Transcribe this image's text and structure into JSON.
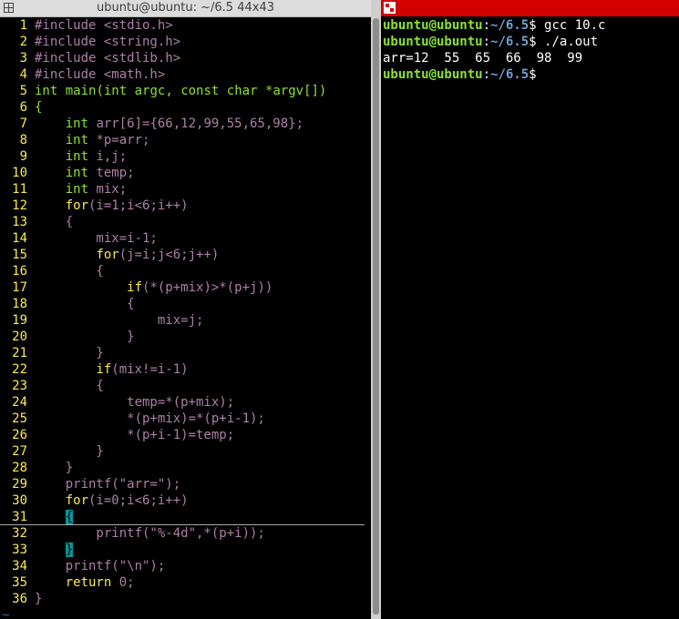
{
  "left_window": {
    "title": "ubuntu@ubuntu: ~/6.5 44x43",
    "lines": [
      {
        "n": "1",
        "parts": [
          [
            "c-pre",
            "#include "
          ],
          [
            "c-str",
            "<stdio.h>"
          ]
        ]
      },
      {
        "n": "2",
        "parts": [
          [
            "c-pre",
            "#include "
          ],
          [
            "c-str",
            "<string.h>"
          ]
        ]
      },
      {
        "n": "3",
        "parts": [
          [
            "c-pre",
            "#include "
          ],
          [
            "c-str",
            "<stdlib.h>"
          ]
        ]
      },
      {
        "n": "4",
        "parts": [
          [
            "c-pre",
            "#include "
          ],
          [
            "c-str",
            "<math.h>"
          ]
        ]
      },
      {
        "n": "5",
        "parts": [
          [
            "c-type",
            "int"
          ],
          [
            "c-type",
            " main("
          ],
          [
            "c-type",
            "int"
          ],
          [
            "c-type",
            " argc, "
          ],
          [
            "c-type",
            "const"
          ],
          [
            "c-type",
            " "
          ],
          [
            "c-type",
            "char"
          ],
          [
            "c-type",
            " *argv[])"
          ]
        ]
      },
      {
        "n": "6",
        "parts": [
          [
            "c-type",
            "{"
          ]
        ]
      },
      {
        "n": "7",
        "parts": [
          [
            "c-brace",
            "    "
          ],
          [
            "c-type",
            "int"
          ],
          [
            "c-plain",
            " arr[6]={66,12,99,55,65,98};"
          ]
        ]
      },
      {
        "n": "8",
        "parts": [
          [
            "c-brace",
            "    "
          ],
          [
            "c-type",
            "int"
          ],
          [
            "c-plain",
            " *p=arr;"
          ]
        ]
      },
      {
        "n": "9",
        "parts": [
          [
            "c-brace",
            "    "
          ],
          [
            "c-type",
            "int"
          ],
          [
            "c-plain",
            " i,j;"
          ]
        ]
      },
      {
        "n": "10",
        "parts": [
          [
            "c-brace",
            "    "
          ],
          [
            "c-type",
            "int"
          ],
          [
            "c-plain",
            " temp;"
          ]
        ]
      },
      {
        "n": "11",
        "parts": [
          [
            "c-brace",
            "    "
          ],
          [
            "c-type",
            "int"
          ],
          [
            "c-plain",
            " mix;"
          ]
        ]
      },
      {
        "n": "12",
        "parts": [
          [
            "c-brace",
            "    "
          ],
          [
            "c-kw",
            "for"
          ],
          [
            "c-plain",
            "(i=1;i<6;i++)"
          ]
        ]
      },
      {
        "n": "13",
        "parts": [
          [
            "c-plain",
            "    {"
          ]
        ]
      },
      {
        "n": "14",
        "parts": [
          [
            "c-plain",
            "        mix=i-1;"
          ]
        ]
      },
      {
        "n": "15",
        "parts": [
          [
            "c-brace",
            "        "
          ],
          [
            "c-kw",
            "for"
          ],
          [
            "c-plain",
            "(j=i;j<6;j++)"
          ]
        ]
      },
      {
        "n": "16",
        "parts": [
          [
            "c-plain",
            "        {"
          ]
        ]
      },
      {
        "n": "17",
        "parts": [
          [
            "c-brace",
            "            "
          ],
          [
            "c-kw",
            "if"
          ],
          [
            "c-plain",
            "(*(p+mix)>*(p+j))"
          ]
        ]
      },
      {
        "n": "18",
        "parts": [
          [
            "c-plain",
            "            {"
          ]
        ]
      },
      {
        "n": "19",
        "parts": [
          [
            "c-plain",
            "                mix=j;"
          ]
        ]
      },
      {
        "n": "20",
        "parts": [
          [
            "c-plain",
            "            }"
          ]
        ]
      },
      {
        "n": "21",
        "parts": [
          [
            "c-plain",
            "        }"
          ]
        ]
      },
      {
        "n": "22",
        "parts": [
          [
            "c-brace",
            "        "
          ],
          [
            "c-kw",
            "if"
          ],
          [
            "c-plain",
            "(mix!=i-1)"
          ]
        ]
      },
      {
        "n": "23",
        "parts": [
          [
            "c-plain",
            "        {"
          ]
        ]
      },
      {
        "n": "24",
        "parts": [
          [
            "c-plain",
            "            temp=*(p+mix);"
          ]
        ]
      },
      {
        "n": "25",
        "parts": [
          [
            "c-plain",
            "            *(p+mix)=*(p+i-1);"
          ]
        ]
      },
      {
        "n": "26",
        "parts": [
          [
            "c-plain",
            "            *(p+i-1)=temp;"
          ]
        ]
      },
      {
        "n": "27",
        "parts": [
          [
            "c-plain",
            "        }"
          ]
        ]
      },
      {
        "n": "28",
        "parts": [
          [
            "c-plain",
            "    }"
          ]
        ]
      },
      {
        "n": "29",
        "parts": [
          [
            "c-plain",
            "    printf(\"arr=\");"
          ]
        ]
      },
      {
        "n": "30",
        "parts": [
          [
            "c-brace",
            "    "
          ],
          [
            "c-kw",
            "for"
          ],
          [
            "c-plain",
            "(i=0;i<6;i++)"
          ]
        ]
      },
      {
        "n": "31",
        "parts": [
          [
            "c-brace",
            "    "
          ],
          [
            "c-match",
            "{"
          ]
        ],
        "cursor": true
      },
      {
        "n": "32",
        "parts": [
          [
            "c-plain",
            "        printf(\"%-4d\",*(p+i));"
          ]
        ]
      },
      {
        "n": "33",
        "parts": [
          [
            "c-brace",
            "    "
          ],
          [
            "c-match",
            "}"
          ]
        ]
      },
      {
        "n": "34",
        "parts": [
          [
            "c-plain",
            "    printf(\"\\n\");"
          ]
        ]
      },
      {
        "n": "35",
        "parts": [
          [
            "c-brace",
            "    "
          ],
          [
            "c-kw",
            "return"
          ],
          [
            "c-num",
            " 0"
          ],
          [
            "c-plain",
            ";"
          ]
        ]
      },
      {
        "n": "36",
        "parts": [
          [
            "c-plain",
            "}"
          ]
        ]
      }
    ],
    "tilde": "~"
  },
  "right_window": {
    "lines": [
      {
        "user": "ubuntu@ubuntu",
        "sep": ":",
        "path": "~/6.5",
        "cmd": "$ gcc 10.c"
      },
      {
        "user": "ubuntu@ubuntu",
        "sep": ":",
        "path": "~/6.5",
        "cmd": "$ ./a.out"
      },
      {
        "output": "arr=12  55  65  66  98  99"
      },
      {
        "user": "ubuntu@ubuntu",
        "sep": ":",
        "path": "~/6.5",
        "cmd": "$"
      }
    ]
  }
}
